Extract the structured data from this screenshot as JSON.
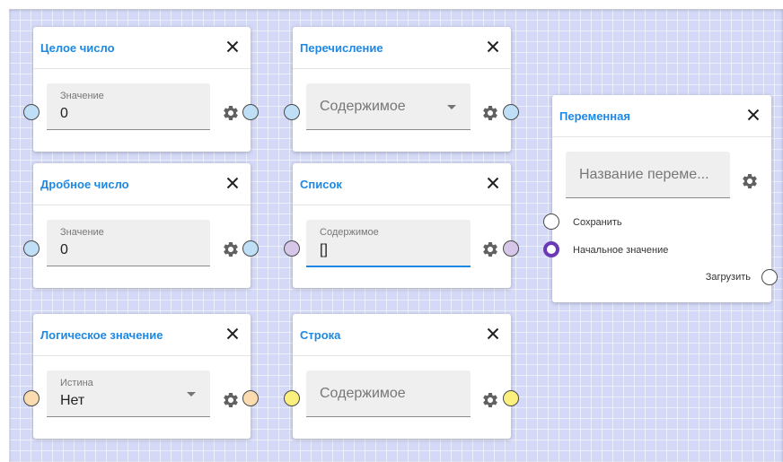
{
  "nodes": {
    "integer": {
      "title": "Целое число",
      "field_label": "Значение",
      "field_value": "0"
    },
    "enum": {
      "title": "Перечисление",
      "placeholder": "Содержимое"
    },
    "variable": {
      "title": "Переменная",
      "name_placeholder": "Название переме...",
      "ports": {
        "save": "Сохранить",
        "initial": "Начальное значение",
        "load": "Загрузить"
      }
    },
    "float": {
      "title": "Дробное число",
      "field_label": "Значение",
      "field_value": "0"
    },
    "list": {
      "title": "Список",
      "field_label": "Содержимое",
      "field_value": "[]"
    },
    "boolean": {
      "title": "Логическое значение",
      "field_label": "Истина",
      "field_value": "Нет"
    },
    "string": {
      "title": "Строка",
      "placeholder": "Содержимое"
    }
  },
  "icons": {
    "close": "close-icon",
    "settings": "gear-icon",
    "dropdown": "chevron-down-icon"
  },
  "colors": {
    "accent": "#1e88e5",
    "canvas": "#d3d9f7",
    "port_number": "#bfdff7",
    "port_list": "#d6c7e8",
    "port_boolean": "#fbdcb0",
    "port_string": "#fbef7d",
    "port_active_ring": "#6a3ab6"
  }
}
